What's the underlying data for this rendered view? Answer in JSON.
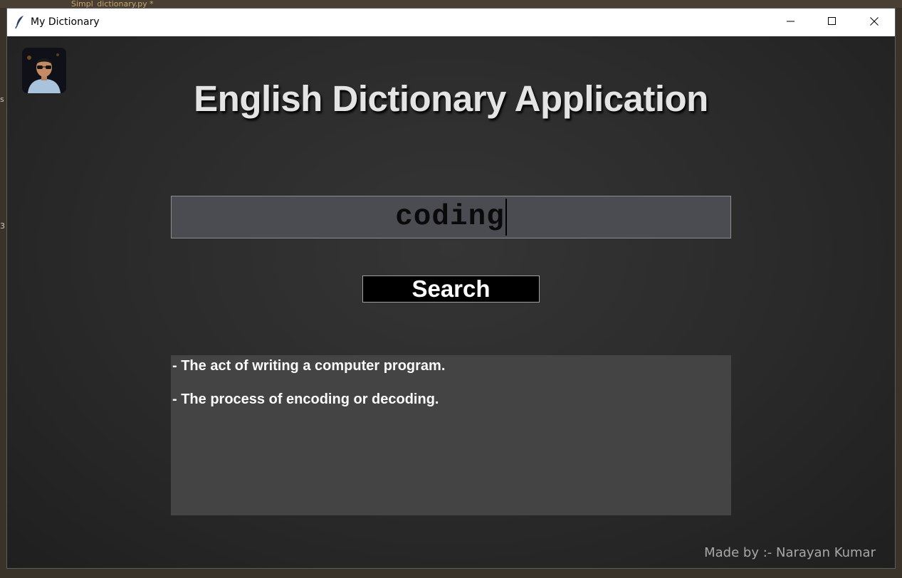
{
  "desktop": {
    "top_text": "Simpl_dictionary.py *",
    "side_chars": [
      "s",
      "3"
    ]
  },
  "window": {
    "title": "My Dictionary",
    "icons": {
      "app": "feather-icon",
      "minimize": "minimize-icon",
      "maximize": "maximize-icon",
      "close": "close-icon"
    }
  },
  "app": {
    "heading": "English Dictionary Application",
    "search": {
      "value": "coding",
      "placeholder": ""
    },
    "search_button": "Search",
    "results": [
      "- The act of writing a computer program.",
      "- The process of encoding or decoding."
    ],
    "footer": "Made by :- Narayan Kumar"
  }
}
